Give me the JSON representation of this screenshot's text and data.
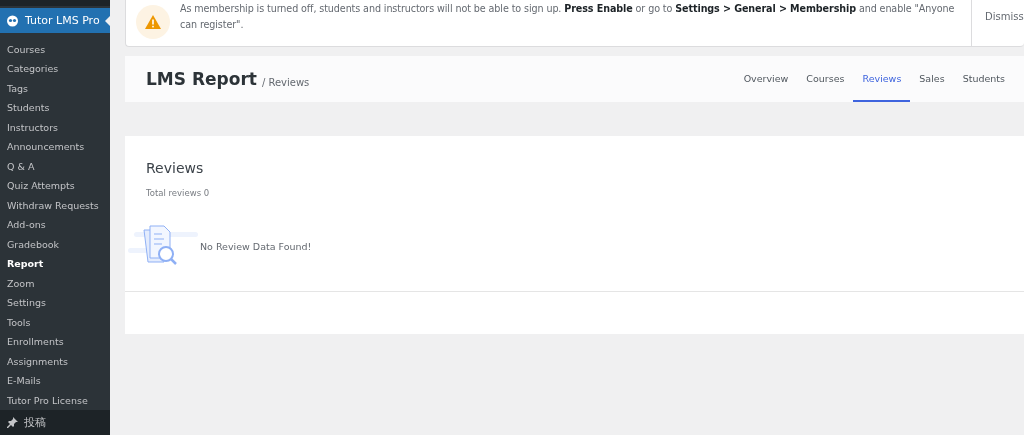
{
  "sidebar": {
    "menu": {
      "label": "Tutor LMS Pro",
      "selected": true
    },
    "items": [
      {
        "label": "Courses",
        "selected": false
      },
      {
        "label": "Categories",
        "selected": false
      },
      {
        "label": "Tags",
        "selected": false
      },
      {
        "label": "Students",
        "selected": false
      },
      {
        "label": "Instructors",
        "selected": false
      },
      {
        "label": "Announcements",
        "selected": false
      },
      {
        "label": "Q & A",
        "selected": false
      },
      {
        "label": "Quiz Attempts",
        "selected": false
      },
      {
        "label": "Withdraw Requests",
        "selected": false
      },
      {
        "label": "Add-ons",
        "selected": false
      },
      {
        "label": "Gradebook",
        "selected": false
      },
      {
        "label": "Report",
        "selected": true
      },
      {
        "label": "Zoom",
        "selected": false
      },
      {
        "label": "Settings",
        "selected": false
      },
      {
        "label": "Tools",
        "selected": false
      },
      {
        "label": "Enrollments",
        "selected": false
      },
      {
        "label": "Assignments",
        "selected": false
      },
      {
        "label": "E-Mails",
        "selected": false
      },
      {
        "label": "Tutor Pro License",
        "selected": false
      }
    ],
    "next_menu": {
      "label": "投稿"
    }
  },
  "notice": {
    "message": "As membership is turned off, students and instructors will not be able to sign up. **Press Enable** or go to **Settings > General > Membership** and enable \"Anyone can register\".",
    "buttons": [
      "Dismiss"
    ]
  },
  "header": {
    "title": "LMS Report",
    "breadcrumb": "/ Reviews",
    "tabs": [
      {
        "label": "Overview",
        "selected": false
      },
      {
        "label": "Courses",
        "selected": false
      },
      {
        "label": "Reviews",
        "selected": true
      },
      {
        "label": "Sales",
        "selected": false
      },
      {
        "label": "Students",
        "selected": false
      }
    ]
  },
  "reviews": {
    "title": "Reviews",
    "total": "Total reviews 0",
    "empty_message": "No Review Data Found!"
  }
}
